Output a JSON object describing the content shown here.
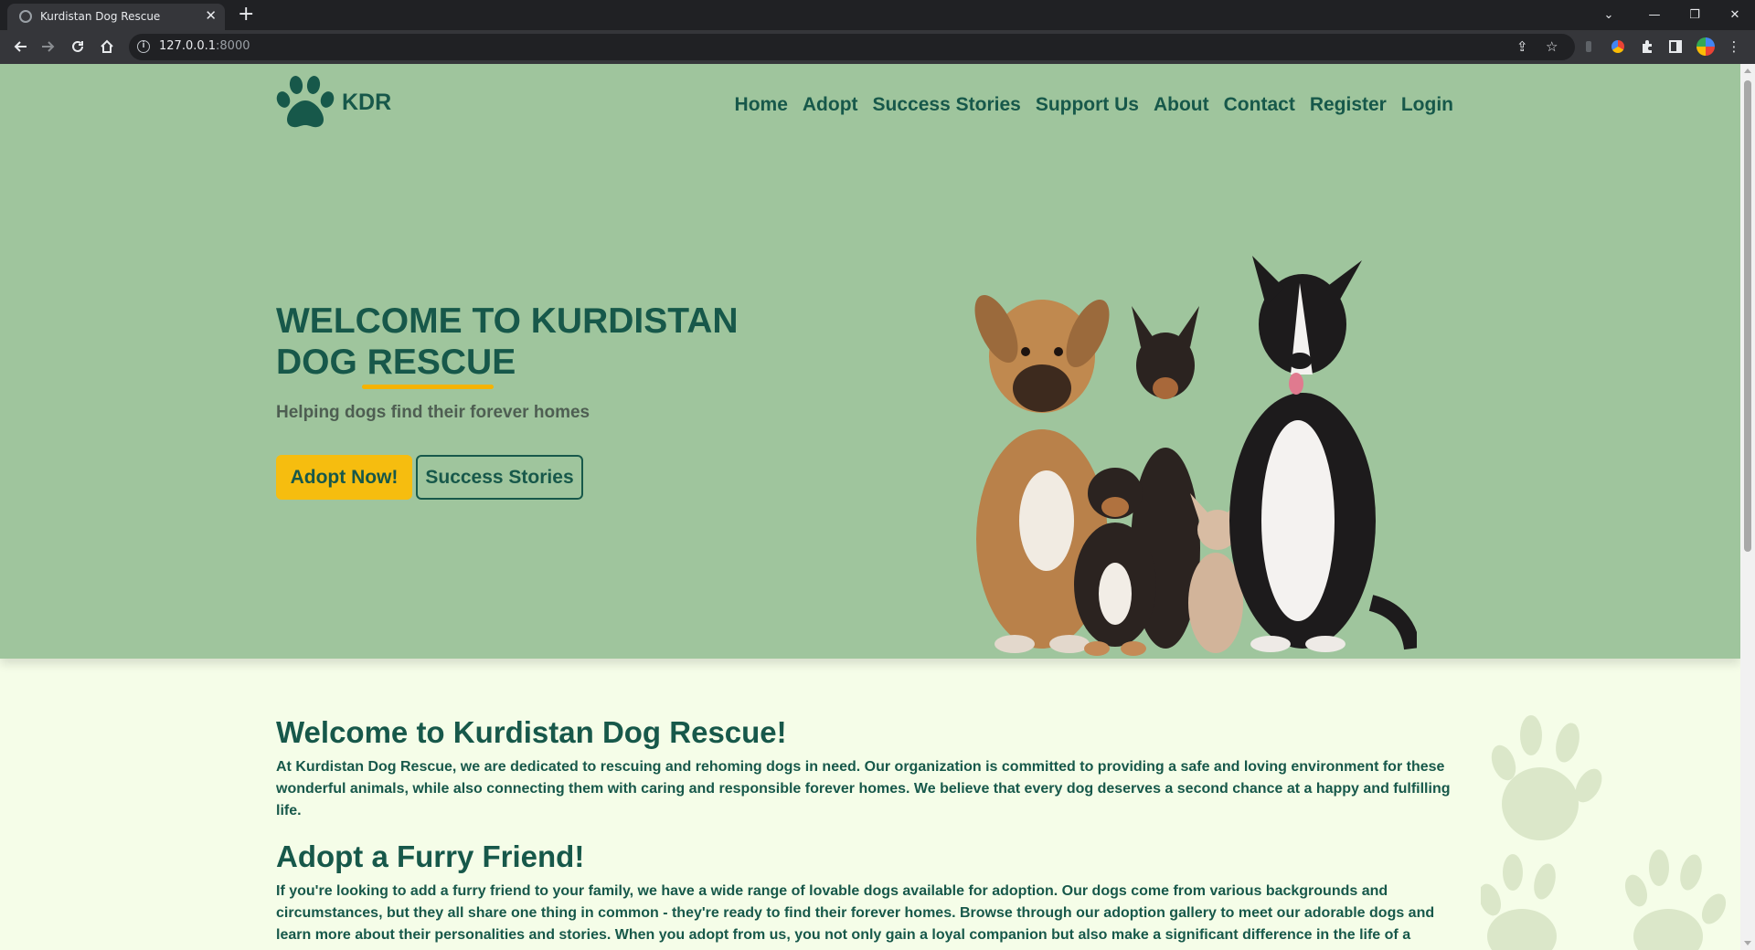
{
  "browser": {
    "tab_title": "Kurdistan Dog Rescue",
    "tab_close": "✕",
    "new_tab": "+",
    "url_host": "127.0.0.1",
    "url_port": ":8000"
  },
  "site": {
    "logo_text": "KDR",
    "nav": [
      "Home",
      "Adopt",
      "Success Stories",
      "Support Us",
      "About",
      "Contact",
      "Register",
      "Login"
    ]
  },
  "hero": {
    "title": "WELCOME TO KURDISTAN DOG RESCUE",
    "subtitle": "Helping dogs find their forever homes",
    "adopt_button": "Adopt Now!",
    "stories_button": "Success Stories"
  },
  "content": {
    "welcome_heading": "Welcome to Kurdistan Dog Rescue!",
    "welcome_text": "At Kurdistan Dog Rescue, we are dedicated to rescuing and rehoming dogs in need. Our organization is committed to providing a safe and loving environment for these wonderful animals, while also connecting them with caring and responsible forever homes. We believe that every dog deserves a second chance at a happy and fulfilling life.",
    "adopt_heading": "Adopt a Furry Friend!",
    "adopt_text": "If you're looking to add a furry friend to your family, we have a wide range of lovable dogs available for adoption. Our dogs come from various backgrounds and circumstances, but they all share one thing in common - they're ready to find their forever homes. Browse through our adoption gallery to meet our adorable dogs and learn more about their personalities and stories. When you adopt from us, you not only gain a loyal companion but also make a significant difference in the life of a"
  },
  "colors": {
    "hero_bg": "#9fc59d",
    "page_bg": "#f5fde8",
    "brand_green": "#17584a",
    "accent_yellow": "#f6bd0f"
  },
  "icons": [
    "back-arrow-icon",
    "forward-arrow-icon",
    "reload-icon",
    "home-icon",
    "info-icon",
    "share-icon",
    "star-icon",
    "puzzle-icon",
    "sidepanel-icon",
    "menu-icon",
    "paw-icon"
  ]
}
